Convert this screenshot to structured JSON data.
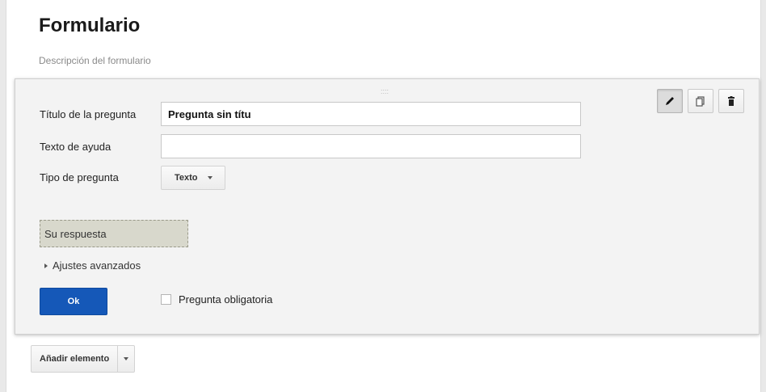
{
  "form": {
    "title": "Formulario",
    "description": "Descripción del formulario"
  },
  "question": {
    "drag_handle": "::::",
    "toolbar": {
      "edit_icon": "pencil-icon",
      "duplicate_icon": "copy-icon",
      "delete_icon": "trash-icon"
    },
    "title_label": "Título de la pregunta",
    "title_value": "Pregunta sin títu",
    "help_label": "Texto de ayuda",
    "help_value": "",
    "type_label": "Tipo de pregunta",
    "type_value": "Texto",
    "answer_placeholder": "Su respuesta",
    "advanced_label": "Ajustes avanzados",
    "ok_label": "Ok",
    "required_label": "Pregunta obligatoria",
    "required_checked": false
  },
  "footer": {
    "add_element_label": "Añadir elemento"
  },
  "colors": {
    "primary_button": "#1558b8",
    "answer_preview_bg": "#d8d8cc",
    "card_bg": "#f3f3f3"
  }
}
